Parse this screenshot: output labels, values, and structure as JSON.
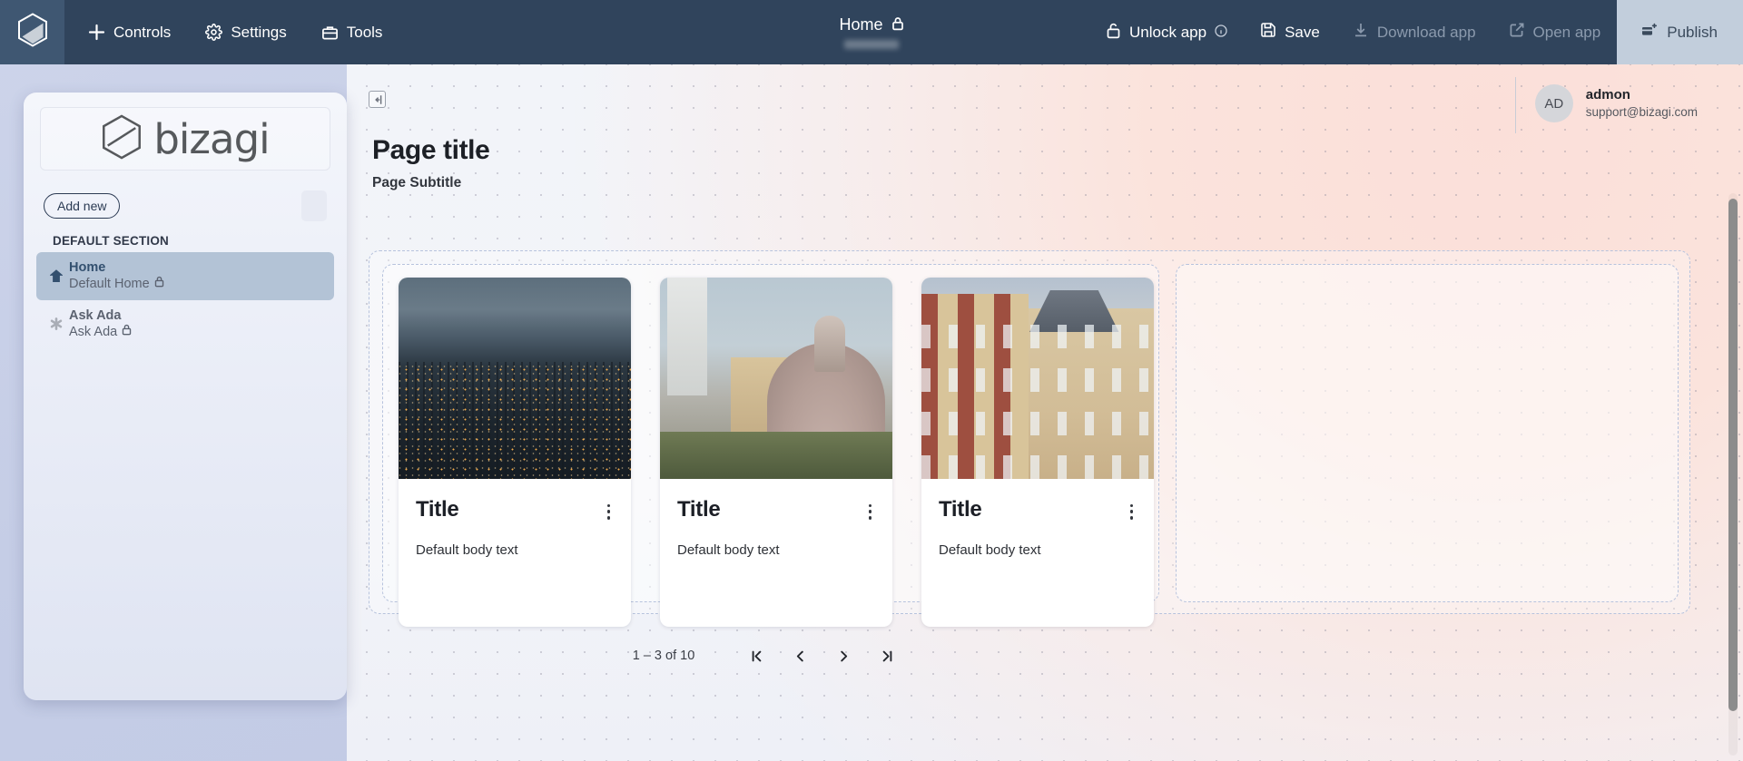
{
  "topbar": {
    "logo_icon": "bizagi-hex-logo-icon",
    "nav": [
      {
        "label": "Controls",
        "icon": "plus-icon"
      },
      {
        "label": "Settings",
        "icon": "gear-icon"
      },
      {
        "label": "Tools",
        "icon": "toolbox-icon"
      }
    ],
    "center": {
      "title": "Home",
      "lock_icon": "lock-icon",
      "subtitle_blurred": ""
    },
    "actions": [
      {
        "label": "Unlock app",
        "icon": "unlock-icon",
        "info_icon": "info-icon",
        "dim": false
      },
      {
        "label": "Save",
        "icon": "floppy-save-icon",
        "dim": false
      },
      {
        "label": "Download app",
        "icon": "download-icon",
        "dim": true
      },
      {
        "label": "Open app",
        "icon": "external-link-icon",
        "dim": true
      }
    ],
    "publish": {
      "label": "Publish",
      "icon": "publish-icon"
    }
  },
  "sidebar": {
    "brand": "bizagi",
    "brand_icon": "bizagi-hex-logo-icon",
    "add_new_label": "Add new",
    "kebab_icon": "more-vertical-icon",
    "section_label": "DEFAULT SECTION",
    "items": [
      {
        "icon": "home-icon",
        "title": "Home",
        "subtitle": "Default Home",
        "lock_icon": "lock-icon",
        "active": true
      },
      {
        "icon": "asterisk-icon",
        "title": "Ask Ada",
        "subtitle": "Ask Ada",
        "lock_icon": "lock-icon",
        "active": false
      }
    ]
  },
  "canvas": {
    "collapse_icon": "collapse-panel-icon",
    "profile": {
      "initials": "AD",
      "name": "admon",
      "email": "support@bizagi.com"
    },
    "page_title": "Page title",
    "page_subtitle": "Page Subtitle",
    "cards": [
      {
        "title": "Title",
        "body": "Default body text",
        "image": "city-skyline-dusk-photo",
        "kebab_icon": "more-vertical-icon"
      },
      {
        "title": "Title",
        "body": "Default body text",
        "image": "rome-dome-cityscape-photo",
        "kebab_icon": "more-vertical-icon"
      },
      {
        "title": "Title",
        "body": "Default body text",
        "image": "baroque-palace-facade-photo",
        "kebab_icon": "more-vertical-icon"
      }
    ],
    "pagination": {
      "range_label": "1 – 3 of 10",
      "first_icon": "first-page-icon",
      "prev_icon": "chevron-left-icon",
      "next_icon": "chevron-right-icon",
      "last_icon": "last-page-icon"
    }
  },
  "colors": {
    "topbar_bg": "#30445c",
    "topbar_logo_bg": "#3f5772",
    "publish_bg": "#c2cedc",
    "nav_active_bg": "#b3c3d6",
    "nav_active_text": "#33506f",
    "canvas_accent_pink": "#fbe3dc",
    "dashed_border": "#b7c3dd",
    "scrollbar_thumb": "#8c8c8c"
  }
}
